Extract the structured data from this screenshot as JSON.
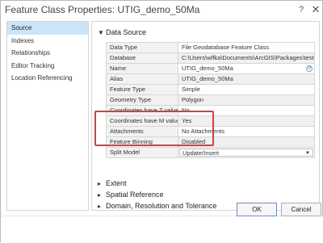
{
  "window": {
    "title": "Feature Class Properties: UTIG_demo_50Ma",
    "help_glyph": "?",
    "close_glyph": "✕"
  },
  "sidebar": {
    "items": [
      {
        "label": "Source",
        "active": true
      },
      {
        "label": "Indexes",
        "active": false
      },
      {
        "label": "Relationships",
        "active": false
      },
      {
        "label": "Editor Tracking",
        "active": false
      },
      {
        "label": "Location Referencing",
        "active": false
      }
    ]
  },
  "data_source": {
    "header": "Data Source",
    "rows": [
      {
        "key": "Data Type",
        "value": "File Geodatabase Feature Class"
      },
      {
        "key": "Database",
        "value": "C:\\Users\\wlfka\\Documents\\ArcGIS\\Packages\\testPro"
      },
      {
        "key": "Name",
        "value": "UTIG_demo_50Ma"
      },
      {
        "key": "Alias",
        "value": "UTIG_demo_50Ma"
      },
      {
        "key": "Feature Type",
        "value": "Simple"
      },
      {
        "key": "Geometry Type",
        "value": "Polygon"
      },
      {
        "key": "Coordinates have Z value",
        "value": "No"
      },
      {
        "key": "Coordinates have M value",
        "value": "Yes"
      },
      {
        "key": "Attachments",
        "value": "No Attachments"
      },
      {
        "key": "Feature Binning",
        "value": "Disabled"
      },
      {
        "key": "Split Model",
        "value": "Update/Insert"
      }
    ]
  },
  "sections": {
    "extent": "Extent",
    "spatial_reference": "Spatial Reference",
    "domain": "Domain, Resolution and Tolerance"
  },
  "buttons": {
    "ok": "OK",
    "cancel": "Cancel"
  },
  "colors": {
    "highlight": "#e03a3a",
    "active_item": "#cce4f7"
  },
  "icons": {
    "clear": "clear-icon",
    "chevron_down": "chevron-down-icon",
    "chevron_right": "chevron-right-icon"
  }
}
